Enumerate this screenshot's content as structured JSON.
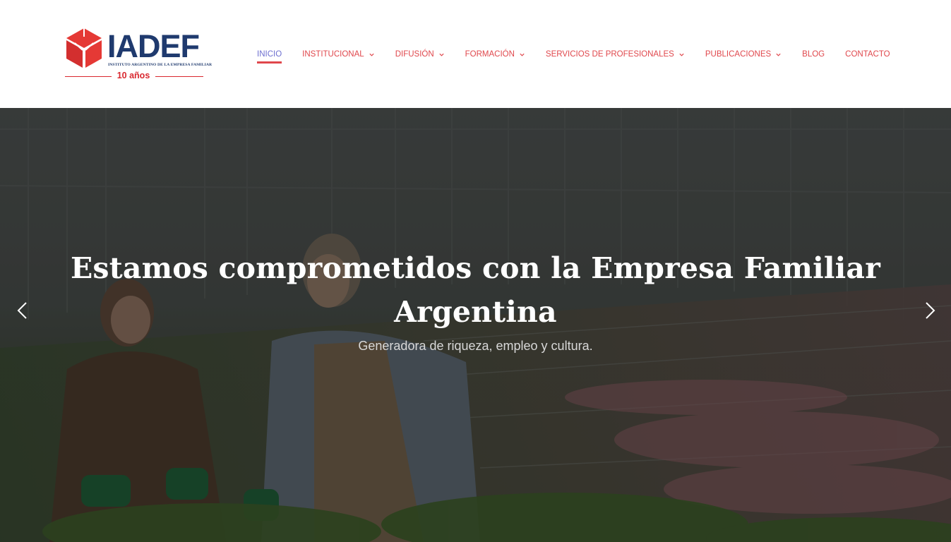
{
  "logo": {
    "wordmark": "IADEF",
    "subtitle": "INSTITUTO ARGENTINO DE LA EMPRESA FAMILIAR",
    "years": "10 años",
    "colors": {
      "red": "#e53935",
      "navy": "#1f3a6e"
    }
  },
  "nav": {
    "items": [
      {
        "label": "INICIO",
        "active": true,
        "has_dropdown": false
      },
      {
        "label": "INSTITUCIONAL",
        "active": false,
        "has_dropdown": true
      },
      {
        "label": "DIFUSIÓN",
        "active": false,
        "has_dropdown": true
      },
      {
        "label": "FORMACIÓN",
        "active": false,
        "has_dropdown": true
      },
      {
        "label": "SERVICIOS DE PROFESIONALES",
        "active": false,
        "has_dropdown": true
      },
      {
        "label": "PUBLICACIONES",
        "active": false,
        "has_dropdown": true
      },
      {
        "label": "BLOG",
        "active": false,
        "has_dropdown": false
      },
      {
        "label": "CONTACTO",
        "active": false,
        "has_dropdown": false
      }
    ],
    "colors": {
      "link": "#e0474c",
      "active": "#6d6fd0"
    }
  },
  "hero": {
    "title": "Estamos comprometidos con la Empresa Familiar Argentina",
    "subtitle": "Generadora de riqueza, empleo y cultura.",
    "prev_icon": "chevron-left-icon",
    "next_icon": "chevron-right-icon"
  }
}
